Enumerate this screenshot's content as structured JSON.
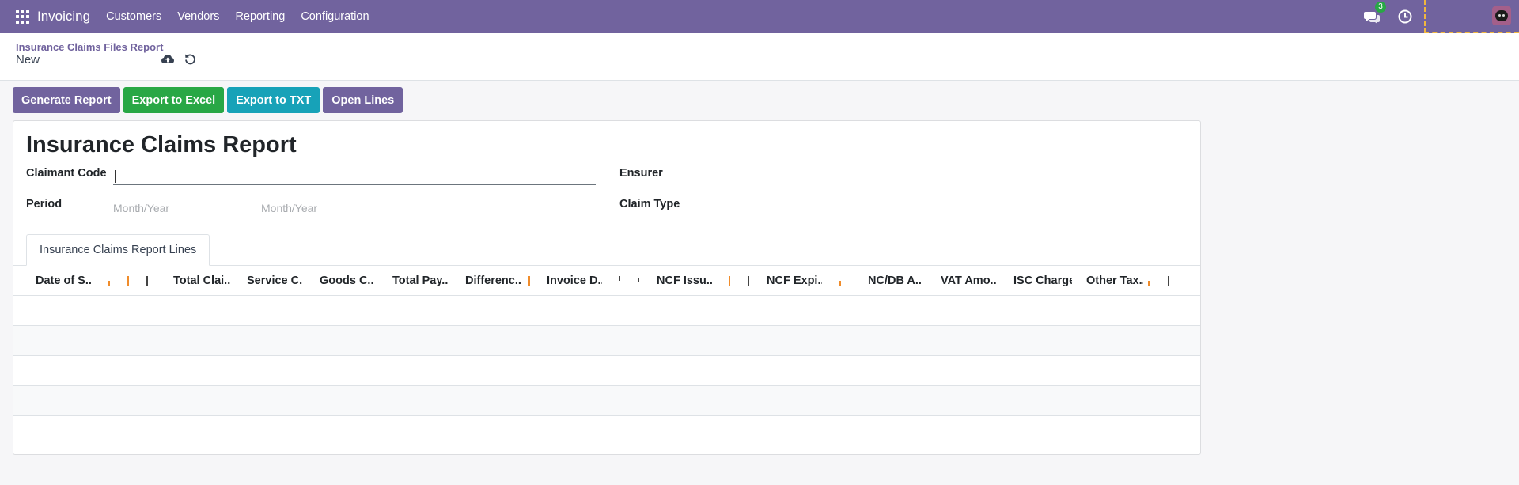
{
  "navbar": {
    "brand": "Invoicing",
    "menu": [
      "Customers",
      "Vendors",
      "Reporting",
      "Configuration"
    ],
    "chat_badge": "3"
  },
  "control_panel": {
    "breadcrumb": "Insurance Claims Files Report",
    "record_name": "New"
  },
  "buttons": {
    "generate": "Generate Report",
    "export_excel": "Export to Excel",
    "export_txt": "Export to TXT",
    "open_lines": "Open Lines"
  },
  "form": {
    "title": "Insurance Claims Report",
    "claimant_code_label": "Claimant Code",
    "claimant_code_value": "",
    "period_label": "Period",
    "period_from_placeholder": "Month/Year",
    "period_to_placeholder": "Month/Year",
    "ensurer_label": "Ensurer",
    "claim_type_label": "Claim Type"
  },
  "tab": {
    "label": "Insurance Claims Report Lines"
  },
  "table": {
    "columns": [
      "Date of S...",
      "Total Clai...",
      "Service C...",
      "Goods C...",
      "Total Pay...",
      "Differenc...",
      "Invoice D...",
      "NCF Issu...",
      "NCF Expi...",
      "NC/DB A...",
      "VAT Amo...",
      "ISC Charge",
      "Other Tax..."
    ],
    "rows": [
      [],
      [],
      [],
      [],
      []
    ]
  },
  "colors": {
    "primary": "#71639e",
    "success": "#28a745",
    "info": "#17a2b8"
  }
}
